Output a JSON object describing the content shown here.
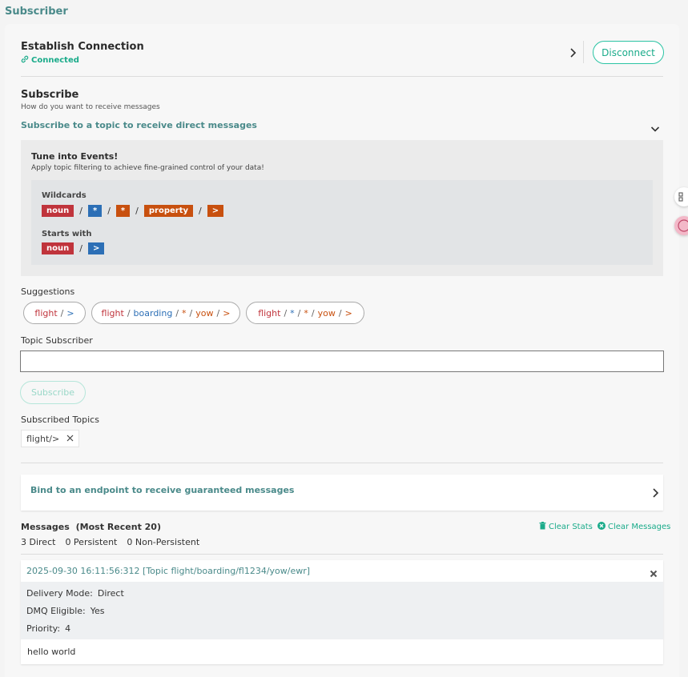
{
  "page": {
    "title": "Subscriber"
  },
  "connection": {
    "title": "Establish Connection",
    "status": "Connected",
    "disconnect_label": "Disconnect"
  },
  "subscribe": {
    "title": "Subscribe",
    "description": "How do you want to receive messages",
    "topic_option": "Subscribe to a topic to receive direct messages",
    "tune": {
      "title": "Tune into Events!",
      "description": "Apply topic filtering to achieve fine-grained control of your data!",
      "wildcards_label": "Wildcards",
      "wildcards_tokens": [
        "noun",
        "*",
        "*",
        "property",
        ">"
      ],
      "starts_with_label": "Starts with",
      "starts_with_tokens": [
        "noun",
        ">"
      ],
      "separator": "/"
    },
    "suggestions_label": "Suggestions",
    "suggestions": [
      {
        "tokens": [
          "flight",
          "/",
          ">"
        ]
      },
      {
        "tokens": [
          "flight",
          "/",
          "boarding",
          "/",
          "*",
          "/",
          "yow",
          "/",
          ">"
        ]
      },
      {
        "tokens": [
          "flight",
          "/",
          "*",
          "/",
          "*",
          "/",
          "yow",
          "/",
          ">"
        ]
      }
    ],
    "topic_subscriber_label": "Topic Subscriber",
    "topic_input_value": "",
    "subscribe_button": "Subscribe",
    "subscribed_topics_label": "Subscribed Topics",
    "subscribed_topics": [
      "flight/>"
    ]
  },
  "bind": {
    "label": "Bind to an endpoint to receive guaranteed messages"
  },
  "messages": {
    "title": "Messages",
    "title_suffix": "(Most Recent 20)",
    "clear_stats": "Clear Stats",
    "clear_messages": "Clear Messages",
    "counts": [
      "3 Direct",
      "0 Persistent",
      "0 Non-Persistent"
    ],
    "items": [
      {
        "header": "2025-09-30 16:11:56:312 [Topic flight/boarding/fl1234/yow/ewr]",
        "delivery_mode_key": "Delivery Mode:",
        "delivery_mode": "Direct",
        "dmq_key": "DMQ Eligible:",
        "dmq": "Yes",
        "priority_key": "Priority:",
        "priority": "4",
        "body": "hello world"
      }
    ]
  },
  "colors": {
    "accent": "#1aab8a",
    "teal_text": "#4a8a8a",
    "token_red": "#c0343c",
    "token_blue": "#2c6fb6",
    "token_orange": "#c8500f"
  },
  "icons": [
    "link-icon",
    "chevron-right-icon",
    "chevron-down-icon",
    "close-icon",
    "trash-icon",
    "clear-circle-icon"
  ]
}
